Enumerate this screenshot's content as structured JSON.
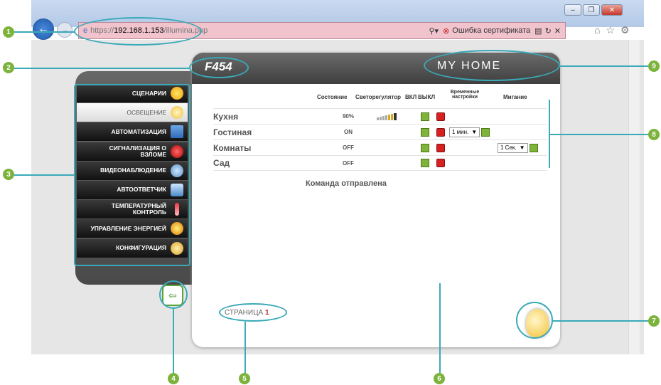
{
  "browser": {
    "url_prefix": "https://",
    "url_host": "192.168.1.153",
    "url_path": "/illumina.php",
    "cert_error": "Ошибка сертификата"
  },
  "sidebar": {
    "items": [
      {
        "label": "СЦЕНАРИИ"
      },
      {
        "label": "ОСВЕЩЕНИЕ"
      },
      {
        "label": "АВТОМАТИЗАЦИЯ"
      },
      {
        "label": "СИГНАЛИЗАЦИЯ О ВЗЛОМЕ"
      },
      {
        "label": "ВИДЕОНАБЛЮДЕНИЕ"
      },
      {
        "label": "АВТООТВЕТЧИК"
      },
      {
        "label": "ТЕМПЕРАТУРНЫЙ КОНТРОЛЬ"
      },
      {
        "label": "УПРАВЛЕНИЕ ЭНЕРГИЕЙ"
      },
      {
        "label": "КОНФИГУРАЦИЯ"
      }
    ]
  },
  "header": {
    "model": "F454",
    "logo": "MY HOME"
  },
  "table": {
    "col_state": "Состояние",
    "col_dimmer": "Светорегулятор",
    "col_on": "ВКЛ",
    "col_off": "ВЫКЛ",
    "col_timer": "Временные настройки",
    "col_blink": "Мигание",
    "rows": [
      {
        "name": "Кухня",
        "state": "90%"
      },
      {
        "name": "Гостиная",
        "state": "ON",
        "timer": "1 мин."
      },
      {
        "name": "Комнаты",
        "state": "OFF",
        "blink": "1 Сек."
      },
      {
        "name": "Сад",
        "state": "OFF"
      }
    ]
  },
  "status_message": "Команда отправлена",
  "pager": {
    "label": "СТРАНИЦА",
    "number": "1"
  },
  "callouts": [
    "1",
    "2",
    "3",
    "4",
    "5",
    "6",
    "7",
    "8",
    "9"
  ]
}
